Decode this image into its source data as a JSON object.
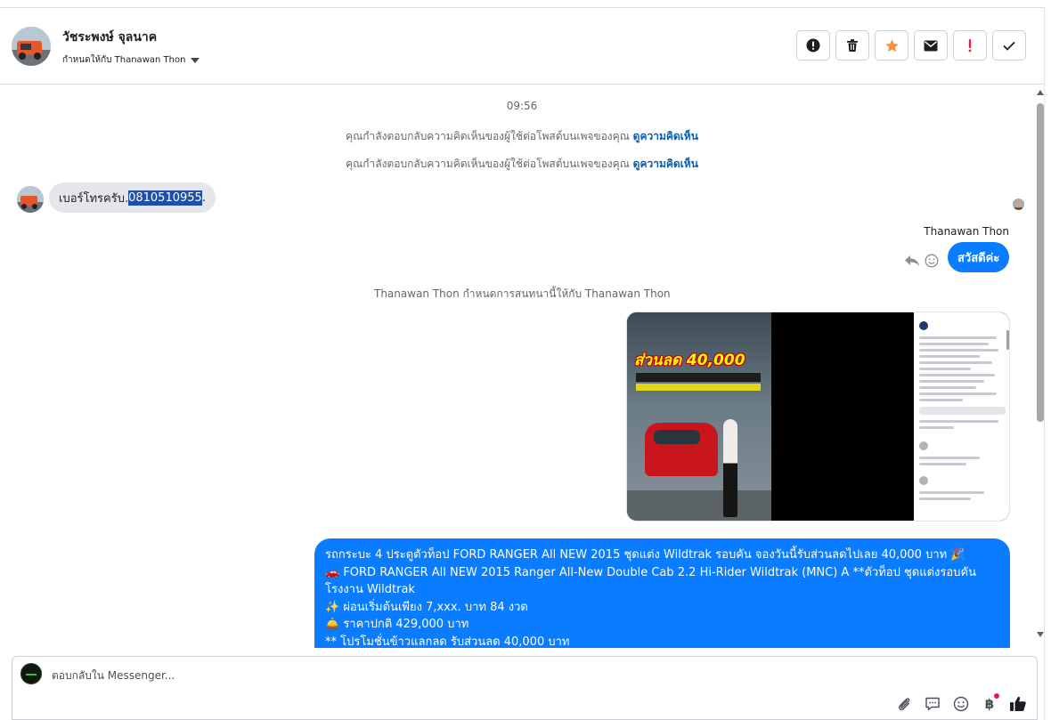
{
  "header": {
    "contact_name": "วัชระพงษ์ จุลนาค",
    "assigned_to": "กำหนดให้กับ Thanawan Thon",
    "actions": [
      {
        "name": "spam",
        "icon": "exclamation-circle-icon"
      },
      {
        "name": "delete",
        "icon": "trash-icon"
      },
      {
        "name": "star",
        "icon": "star-icon"
      },
      {
        "name": "mark-unread",
        "icon": "envelope-icon"
      },
      {
        "name": "follow-up",
        "icon": "exclamation-icon"
      },
      {
        "name": "done",
        "icon": "checkmark-icon"
      }
    ],
    "star_color": "#f7923a",
    "follow_up_color": "#e41e3f"
  },
  "conversation": {
    "timestamp": "09:56",
    "system_notes": [
      {
        "text": "คุณกำลังตอบกลับความคิดเห็นของผู้ใช้ต่อโพสต์บนเพจของคุณ",
        "link": "ดูความคิดเห็น"
      },
      {
        "text": "คุณกำลังตอบกลับความคิดเห็นของผู้ใช้ต่อโพสต์บนเพจของคุณ",
        "link": "ดูความคิดเห็น"
      }
    ],
    "incoming": {
      "prefix": "เบอร์โทรครับ.",
      "highlighted": "0810510955",
      "suffix": "."
    },
    "sender_name": "Thanawan Thon",
    "outgoing_short": "สวัสดีค่ะ",
    "assign_note": "Thanawan Thon กำหนดการสนทนานี้ให้กับ Thanawan Thon",
    "post_image": {
      "promo_text": "ส่วนลด 40,000"
    },
    "long_message": [
      "รถกระบะ 4 ประตูตัวท็อป FORD RANGER All NEW 2015 ชุดแต่ง Wildtrak รอบคัน จองวันนี้รับส่วนลดไปเลย 40,000 บาท 🎉",
      "🚗 FORD RANGER All NEW 2015 Ranger All-New Double Cab 2.2 Hi-Rider Wildtrak (MNC) A **ตัวท็อป ชุดแต่งรอบคัน",
      "โรงงาน Wildtrak",
      "✨ ผ่อนเริ่มต้นเพียง 7,xxx. บาท 84 งวด",
      "🛎️ ราคาปกติ 429,000 บาท",
      "** โปรโมชั่นข้าวแลกลด รับส่วนลด 40,000 บาท"
    ],
    "bubble_color": "#0a7cff"
  },
  "composer": {
    "placeholder": "ตอบกลับใน Messenger...",
    "tools": [
      "paperclip-icon",
      "saved-reply-icon",
      "emoji-icon",
      "baht-icon",
      "thumbs-up-icon"
    ],
    "baht_symbol": "฿"
  }
}
